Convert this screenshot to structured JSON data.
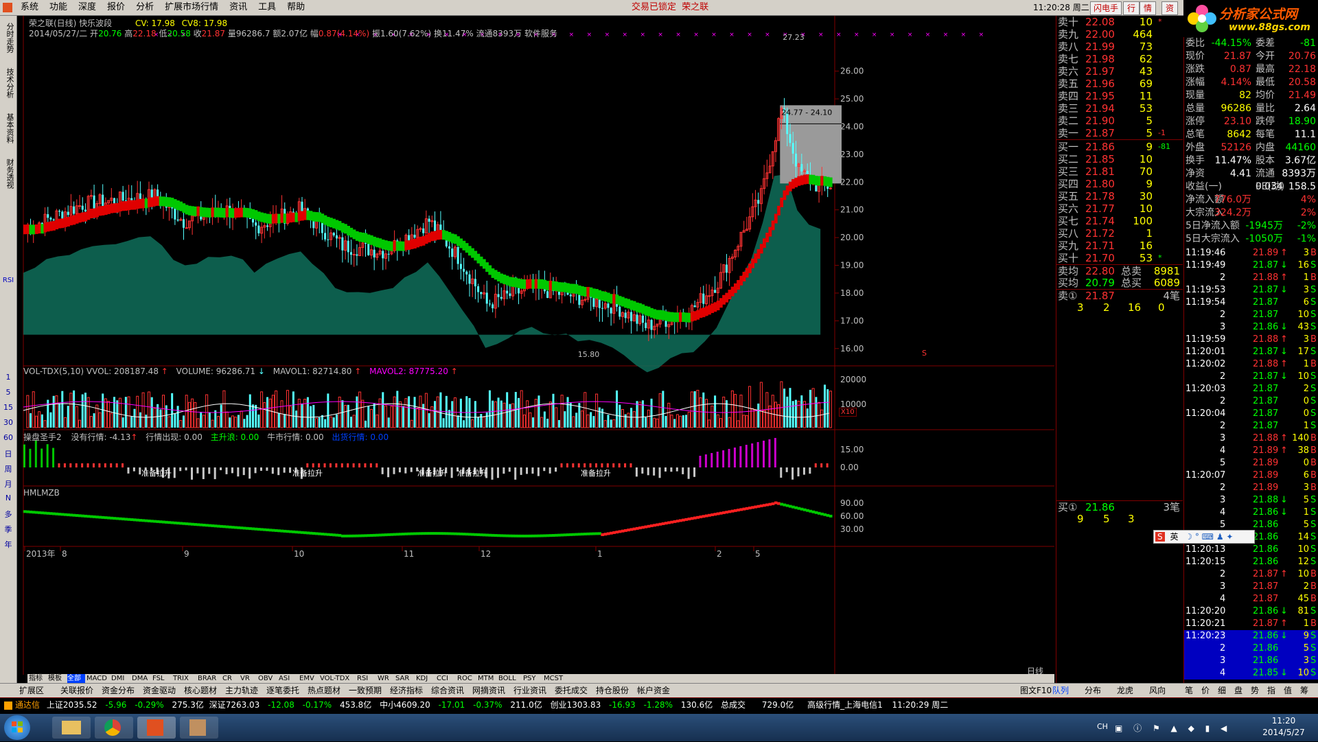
{
  "menu": {
    "items": [
      "系统",
      "功能",
      "深度",
      "报价",
      "分析",
      "扩展市场行情",
      "资讯",
      "工具",
      "帮助"
    ],
    "center_status": "交易已锁定",
    "center_name": "荣之联",
    "clock": "11:20:28 周二",
    "tools": [
      "闪电手",
      "行",
      "情",
      "资"
    ]
  },
  "left_toolbar": {
    "labels": [
      "分时走势",
      "技术分析",
      "基本资料",
      "财务透视"
    ],
    "indicators": [
      "RSI"
    ],
    "periods": [
      "1",
      "5",
      "15",
      "30",
      "60",
      "日",
      "周",
      "月",
      "N",
      "多",
      "季",
      "年"
    ]
  },
  "stock": {
    "title": "荣之联(日线) 快乐波段",
    "cv": "CV: 17.98",
    "cv8": "CV8: 17.98",
    "date": "2014/05/27/二",
    "open_label": "开",
    "open": "20.76",
    "high_label": "高",
    "high": "22.18",
    "low_label": "低",
    "low": "20.58",
    "close_label": "收",
    "close": "21.87",
    "vol_label": "量",
    "volume": "96286.7",
    "amount_label": "额",
    "amount": "2.07亿",
    "change_label": "幅",
    "change": "0.87(4.14%)",
    "amplitude_label": "振",
    "amplitude": "1.60(7.62%)",
    "turnover_label": "换",
    "turnover": "11.47%",
    "float_label": "流通",
    "float": "8393万",
    "sector": "软件服务"
  },
  "main_chart": {
    "price_labels": [
      "26.00",
      "25.00",
      "24.00",
      "23.00",
      "22.00",
      "21.00",
      "20.00",
      "19.00",
      "18.00",
      "17.00",
      "16.00"
    ],
    "price_min": 15.5,
    "price_max": 27.5,
    "high_annot": "27.23",
    "low_annot": "15.80",
    "range_annot": "24.77 - 24.10",
    "s_mark": "S",
    "x_labels": [
      "2013年",
      "8",
      "9",
      "10",
      "11",
      "12",
      "1",
      "2",
      "5"
    ],
    "period_label": "日线"
  },
  "vol_panel": {
    "title": "VOL-TDX(5,10)",
    "vvol": "VVOL: 208187.48",
    "volume": "VOLUME: 96286.71",
    "mavol1": "MAVOL1: 82714.80",
    "mavol2": "MAVOL2: 87775.20",
    "axis": [
      "20000",
      "10000"
    ],
    "unit": "X10"
  },
  "cp_panel": {
    "title": "操盘圣手2",
    "no_trend": "没有行情: -4.13",
    "trend_appear": "行情出现: 0.00",
    "main_rise": "主升浪: 0.00",
    "bull": "牛市行情: 0.00",
    "exit": "出货行情: 0.00",
    "prep_label": "准备拉升",
    "axis": [
      "15.00",
      "0.00"
    ]
  },
  "hm_panel": {
    "title": "HMLMZB",
    "axis": [
      "90.00",
      "60.00",
      "30.00"
    ]
  },
  "indicator_tabs": [
    "指标",
    "模板",
    "全部",
    "MACD",
    "DMI",
    "DMA",
    "FSL",
    "TRIX",
    "BRAR",
    "CR",
    "VR",
    "OBV",
    "ASI",
    "EMV",
    "VOL-TDX",
    "RSI",
    "WR",
    "SAR",
    "KDJ",
    "CCI",
    "ROC",
    "MTM",
    "BOLL",
    "PSY",
    "MCST"
  ],
  "bottom_tabs": [
    "扩展区",
    "关联报价",
    "资金分布",
    "资金驱动",
    "核心题材",
    "主力轨迹",
    "逐笔委托",
    "热点题材",
    "一致预期",
    "经济指标",
    "综合资讯",
    "网摘资讯",
    "行业资讯",
    "委托成交",
    "持仓股份",
    "帐户资金"
  ],
  "right_bottom_tabs": [
    "图文F10",
    "队列",
    "分布",
    "龙虎",
    "风向"
  ],
  "quote_bottom_tabs": [
    "笔",
    "价",
    "细",
    "盘",
    "势",
    "指",
    "值",
    "筹"
  ],
  "order_book": {
    "asks": [
      {
        "label": "卖十",
        "price": "22.08",
        "vol": "10",
        "mark": "*"
      },
      {
        "label": "卖九",
        "price": "22.00",
        "vol": "464",
        "mark": ""
      },
      {
        "label": "卖八",
        "price": "21.99",
        "vol": "73",
        "mark": ""
      },
      {
        "label": "卖七",
        "price": "21.98",
        "vol": "62",
        "mark": ""
      },
      {
        "label": "卖六",
        "price": "21.97",
        "vol": "43",
        "mark": ""
      },
      {
        "label": "卖五",
        "price": "21.96",
        "vol": "69",
        "mark": ""
      },
      {
        "label": "卖四",
        "price": "21.95",
        "vol": "11",
        "mark": ""
      },
      {
        "label": "卖三",
        "price": "21.94",
        "vol": "53",
        "mark": ""
      },
      {
        "label": "卖二",
        "price": "21.90",
        "vol": "5",
        "mark": ""
      },
      {
        "label": "卖一",
        "price": "21.87",
        "vol": "5",
        "mark": "-1"
      }
    ],
    "bids": [
      {
        "label": "买一",
        "price": "21.86",
        "vol": "9",
        "mark": "-81"
      },
      {
        "label": "买二",
        "price": "21.85",
        "vol": "10",
        "mark": ""
      },
      {
        "label": "买三",
        "price": "21.81",
        "vol": "70",
        "mark": ""
      },
      {
        "label": "买四",
        "price": "21.80",
        "vol": "9",
        "mark": ""
      },
      {
        "label": "买五",
        "price": "21.78",
        "vol": "30",
        "mark": ""
      },
      {
        "label": "买六",
        "price": "21.77",
        "vol": "10",
        "mark": ""
      },
      {
        "label": "买七",
        "price": "21.74",
        "vol": "100",
        "mark": ""
      },
      {
        "label": "买八",
        "price": "21.72",
        "vol": "1",
        "mark": ""
      },
      {
        "label": "买九",
        "price": "21.71",
        "vol": "16",
        "mark": ""
      },
      {
        "label": "买十",
        "price": "21.70",
        "vol": "53",
        "mark": "*"
      }
    ],
    "sell_avg_label": "卖均",
    "sell_avg": "22.80",
    "total_sell_label": "总卖",
    "total_sell": "8981",
    "buy_avg_label": "买均",
    "buy_avg": "20.79",
    "total_buy_label": "总买",
    "total_buy": "6089",
    "sell1_queue_label": "卖①",
    "sell1_queue_price": "21.87",
    "sell1_queue_count": "4笔",
    "sell1_queue": [
      "3",
      "2",
      "16",
      "0"
    ],
    "buy1_queue_label": "买①",
    "buy1_queue_price": "21.86",
    "buy1_queue_count": "3笔",
    "buy1_queue": [
      "9",
      "5",
      "3"
    ]
  },
  "logo": {
    "text": "分析家公式网",
    "url": "www.88gs.com"
  },
  "quote": {
    "rows": [
      [
        "委比",
        "-44.15%",
        "委差",
        "-81"
      ],
      [
        "现价",
        "21.87",
        "今开",
        "20.76"
      ],
      [
        "涨跌",
        "0.87",
        "最高",
        "22.18"
      ],
      [
        "涨幅",
        "4.14%",
        "最低",
        "20.58"
      ],
      [
        "现量",
        "82",
        "均价",
        "21.49"
      ],
      [
        "总量",
        "96286",
        "量比",
        "2.64"
      ],
      [
        "涨停",
        "23.10",
        "跌停",
        "18.90"
      ],
      [
        "总笔",
        "8642",
        "每笔",
        "11.1"
      ],
      [
        "外盘",
        "52126",
        "内盘",
        "44160"
      ],
      [
        "换手",
        "11.47%",
        "股本",
        "3.67亿"
      ],
      [
        "净资",
        "4.41",
        "流通",
        "8393万"
      ],
      [
        "收益(一)",
        "0.034",
        "PE(动)",
        "158.5"
      ],
      [
        "净流入额",
        "776.0万",
        "",
        "4%"
      ],
      [
        "大宗流入",
        "324.2万",
        "",
        "2%"
      ],
      [
        "5日净流入额",
        "-1945万",
        "",
        "-2%"
      ],
      [
        "5日大宗流入",
        "-1050万",
        "",
        "-1%"
      ]
    ]
  },
  "ticks": [
    [
      "11:19:46",
      "21.89",
      "↑",
      "3",
      "B"
    ],
    [
      "11:19:49",
      "21.87",
      "↓",
      "16",
      "S"
    ],
    [
      "2",
      "21.88",
      "↑",
      "1",
      "B"
    ],
    [
      "11:19:53",
      "21.87",
      "↓",
      "3",
      "S"
    ],
    [
      "11:19:54",
      "21.87",
      "",
      "6",
      "S"
    ],
    [
      "2",
      "21.87",
      "",
      "10",
      "S"
    ],
    [
      "3",
      "21.86",
      "↓",
      "43",
      "S"
    ],
    [
      "11:19:59",
      "21.88",
      "↑",
      "3",
      "B"
    ],
    [
      "11:20:01",
      "21.87",
      "↓",
      "17",
      "S"
    ],
    [
      "11:20:02",
      "21.88",
      "↑",
      "1",
      "B"
    ],
    [
      "2",
      "21.87",
      "↓",
      "10",
      "S"
    ],
    [
      "11:20:03",
      "21.87",
      "",
      "2",
      "S"
    ],
    [
      "2",
      "21.87",
      "",
      "0",
      "S"
    ],
    [
      "11:20:04",
      "21.87",
      "",
      "0",
      "S"
    ],
    [
      "2",
      "21.87",
      "",
      "1",
      "S"
    ],
    [
      "3",
      "21.88",
      "↑",
      "140",
      "B"
    ],
    [
      "4",
      "21.89",
      "↑",
      "38",
      "B"
    ],
    [
      "5",
      "21.89",
      "",
      "0",
      "B"
    ],
    [
      "11:20:07",
      "21.89",
      "",
      "6",
      "B"
    ],
    [
      "2",
      "21.89",
      "",
      "3",
      "B"
    ],
    [
      "3",
      "21.88",
      "↓",
      "5",
      "S"
    ],
    [
      "4",
      "21.86",
      "↓",
      "1",
      "S"
    ],
    [
      "5",
      "21.86",
      "",
      "5",
      "S"
    ],
    [
      "6",
      "21.86",
      "",
      "14",
      "S"
    ],
    [
      "11:20:13",
      "21.86",
      "",
      "10",
      "S"
    ],
    [
      "11:20:15",
      "21.86",
      "",
      "12",
      "S"
    ],
    [
      "2",
      "21.87",
      "↑",
      "10",
      "B"
    ],
    [
      "3",
      "21.87",
      "",
      "2",
      "B"
    ],
    [
      "4",
      "21.87",
      "",
      "45",
      "B"
    ],
    [
      "11:20:20",
      "21.86",
      "↓",
      "81",
      "S"
    ],
    [
      "11:20:21",
      "21.87",
      "↑",
      "1",
      "B"
    ],
    [
      "11:20:23",
      "21.86",
      "↓",
      "9",
      "S"
    ],
    [
      "2",
      "21.86",
      "",
      "5",
      "S"
    ],
    [
      "3",
      "21.86",
      "",
      "3",
      "S"
    ],
    [
      "4",
      "21.85",
      "↓",
      "10",
      "S"
    ]
  ],
  "index_bar": {
    "brand": "通达信",
    "sh_label": "上证",
    "sh": "2035.52",
    "sh_chg": "-5.96",
    "sh_pct": "-0.29%",
    "sh_amt": "275.3亿",
    "sz_label": "深证",
    "sz": "7263.03",
    "sz_chg": "-12.08",
    "sz_pct": "-0.17%",
    "sz_amt": "453.8亿",
    "zx_label": "中小",
    "zx": "4609.20",
    "zx_chg": "-17.01",
    "zx_pct": "-0.37%",
    "zx_amt": "211.0亿",
    "cy_label": "创业",
    "cy": "1303.83",
    "cy_chg": "-16.93",
    "cy_pct": "-1.28%",
    "cy_amt": "130.6亿",
    "total_label": "总成交",
    "total": "729.0亿",
    "feed": "高级行情_上海电信1",
    "time": "11:20:29 周二"
  },
  "ime": {
    "text": "英"
  },
  "taskbar": {
    "time": "11:20",
    "date": "2014/5/27",
    "lang": "CH"
  },
  "colors": {
    "up": "#ff3232",
    "down": "#54ffff",
    "green": "#00c800",
    "red": "#e00000",
    "teal": "#0f6e5a",
    "grid": "#800000",
    "yellow": "#ffff00",
    "magenta": "#ff00ff"
  }
}
